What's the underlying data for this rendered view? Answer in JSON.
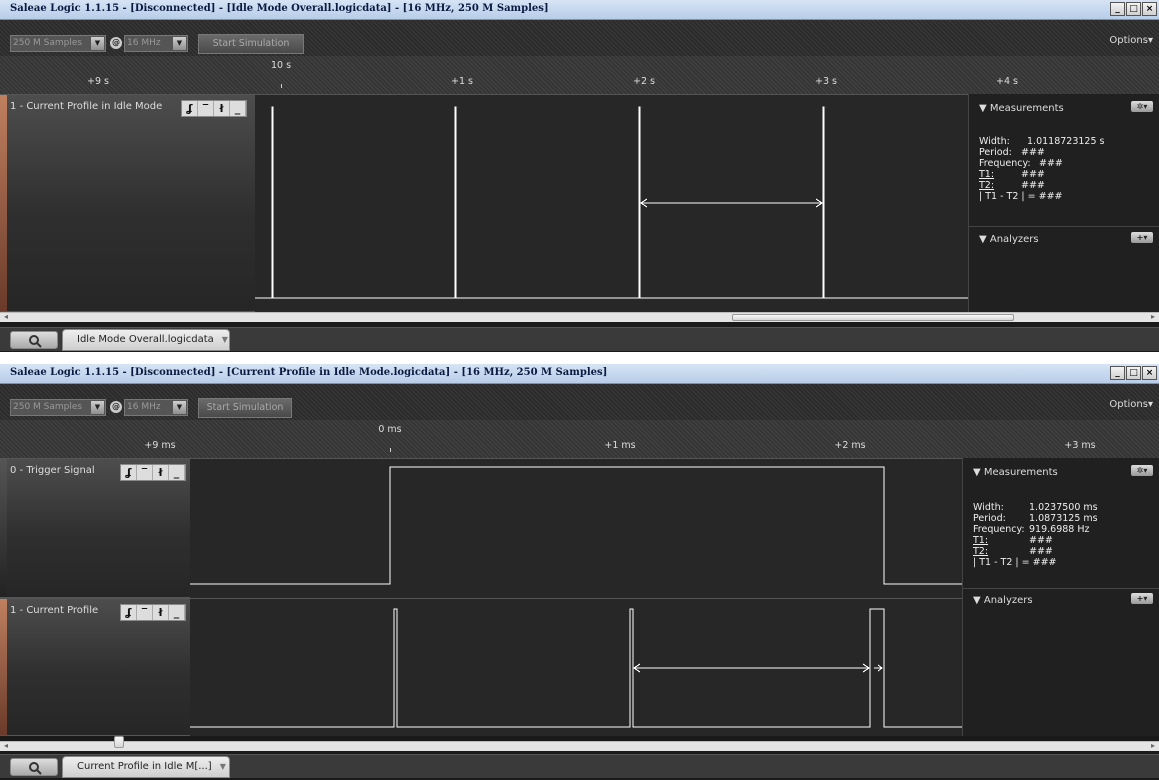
{
  "window1": {
    "title": "Saleae Logic 1.1.15 - [Disconnected] - [Idle Mode Overall.logicdata] - [16 MHz, 250 M Samples]",
    "samples": "250 M Samples",
    "at": "@",
    "rate": "16 MHz",
    "start_simulation": "Start Simulation",
    "options": "Options▾",
    "ruler": {
      "origin": "10 s",
      "ticks": [
        "+9 s",
        "+1 s",
        "+2 s",
        "+3 s",
        "+4 s"
      ]
    },
    "channel": {
      "name": "1 - Current Profile in Idle Mode"
    },
    "measurements": {
      "header": "Measurements",
      "rows": [
        {
          "key": "Width:",
          "value": "1.0118723125 s"
        },
        {
          "key": "Period:",
          "value": "###"
        },
        {
          "key": "Frequency:",
          "value": "###"
        },
        {
          "key": "T1:",
          "value": "###"
        },
        {
          "key": "T2:",
          "value": "###"
        },
        {
          "key": "| T1 - T2 | =",
          "value": "###"
        }
      ]
    },
    "analyzers": {
      "header": "Analyzers"
    },
    "tab": "Idle Mode Overall.logicdata"
  },
  "window2": {
    "title": "Saleae Logic 1.1.15 - [Disconnected] - [Current Profile in Idle Mode.logicdata] - [16 MHz, 250 M Samples]",
    "samples": "250 M Samples",
    "at": "@",
    "rate": "16 MHz",
    "start_simulation": "Start Simulation",
    "options": "Options▾",
    "ruler": {
      "origin": "0 ms",
      "ticks": [
        "+9 ms",
        "+1 ms",
        "+2 ms",
        "+3 ms"
      ]
    },
    "channels": [
      {
        "name": "0 - Trigger Signal"
      },
      {
        "name": "1 - Current Profile"
      }
    ],
    "measurements": {
      "header": "Measurements",
      "rows": [
        {
          "key": "Width:",
          "value": "1.0237500 ms"
        },
        {
          "key": "Period:",
          "value": "1.0873125 ms"
        },
        {
          "key": "Frequency:",
          "value": "919.6988 Hz"
        },
        {
          "key": "T1:",
          "value": "###"
        },
        {
          "key": "T2:",
          "value": "###"
        },
        {
          "key": "| T1 - T2 | =",
          "value": "###"
        }
      ]
    },
    "analyzers": {
      "header": "Analyzers"
    },
    "tab": "Current Profile in Idle M[...]"
  },
  "trigger_buttons": [
    "ʆ",
    "‾",
    "ł",
    "_"
  ],
  "window_buttons": [
    "_",
    "□",
    "×"
  ],
  "colors": {
    "trace": "#ffffff",
    "background": "#272727",
    "titlebar": "#c8d8ee"
  }
}
